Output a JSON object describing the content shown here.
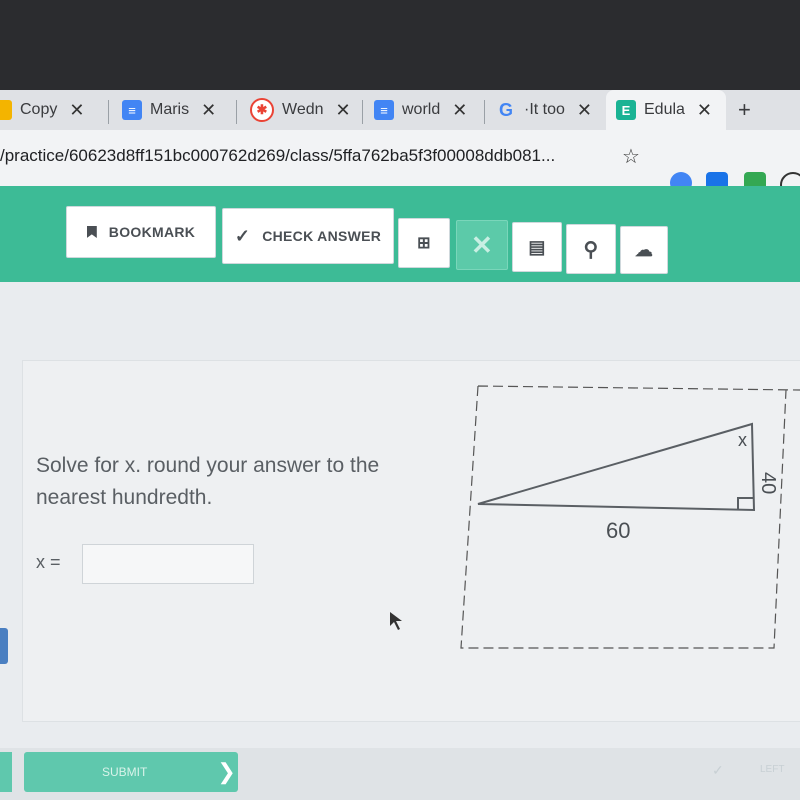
{
  "browser": {
    "tabs": [
      {
        "label": "Copy",
        "icon": "slides-icon",
        "icon_color": "#f4b400",
        "closable": true
      },
      {
        "label": "Maris",
        "icon": "docs-icon",
        "icon_color": "#4285f4",
        "closable": true
      },
      {
        "label": "Wedn",
        "icon": "calendar-icon",
        "icon_color": "#ea4335",
        "closable": true
      },
      {
        "label": "world",
        "icon": "docs-icon",
        "icon_color": "#4285f4",
        "closable": true
      },
      {
        "label": "·It too",
        "icon": "google-icon",
        "icon_color": "#4285f4",
        "closable": true
      },
      {
        "label": "Edula",
        "icon": "edulastic-icon",
        "icon_color": "#1ab394",
        "closable": true,
        "active": true
      }
    ],
    "new_tab_label": "+",
    "url": "/practice/60623d8ff151bc000762d269/class/5ffa762ba5f3f00008ddb081..."
  },
  "toolbar": {
    "bookmark_label": "BOOKMARK",
    "check_answer_label": "CHECK ANSWER",
    "accent_color": "#3dbb96"
  },
  "question": {
    "text": "Solve for x. round your answer to the nearest hundredth.",
    "answer_label": "x =",
    "answer_value": ""
  },
  "figure": {
    "side_bottom": "60",
    "side_right": "40",
    "angle_label": "x"
  },
  "footer": {
    "submit_label": "SUBMIT",
    "right_label": "LEFT"
  }
}
